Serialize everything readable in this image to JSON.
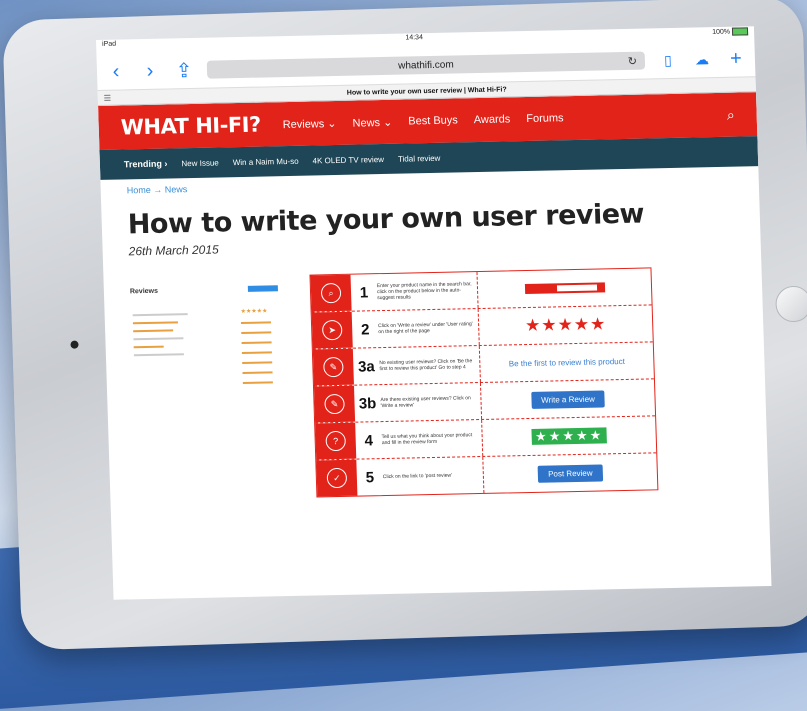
{
  "status": {
    "device": "iPad",
    "time": "14:34",
    "battery": "100%"
  },
  "browser": {
    "url": "whathifi.com",
    "tab_title": "How to write your own user review | What Hi-Fi?"
  },
  "site": {
    "logo": "WHAT HI-FI?",
    "nav": [
      "Reviews ⌄",
      "News ⌄",
      "Best Buys",
      "Awards",
      "Forums"
    ],
    "trending_label": "Trending ›",
    "trending": [
      "New Issue",
      "Win a Naim Mu-so",
      "4K OLED TV review",
      "Tidal review"
    ]
  },
  "article": {
    "breadcrumb": "Home → News",
    "title": "How to write your own user review",
    "date": "26th March 2015"
  },
  "figure": {
    "mini_title": "Reviews",
    "steps": [
      {
        "num": "1",
        "text": "Enter your product name in the search bar, click on the product below in the auto-suggest results",
        "icon": "search-icon"
      },
      {
        "num": "2",
        "text": "Click on 'Write a review' under 'User rating' on the right of the page",
        "icon": "pointer-icon",
        "visual": "★★★★★"
      },
      {
        "num": "3a",
        "text": "No existing user reviews? Click on 'Be the first to review this product' Go to step 4",
        "icon": "pencil-icon",
        "visual": "Be the first to review this product"
      },
      {
        "num": "3b",
        "text": "Are there existing user reviews? Click on 'Write a review'",
        "icon": "pencil-icon",
        "visual": "Write a Review"
      },
      {
        "num": "4",
        "text": "Tell us what you think about your product and fill in the review form",
        "icon": "question-icon",
        "visual": "★★★★★"
      },
      {
        "num": "5",
        "text": "Click on the link to 'post review'",
        "icon": "check-icon",
        "visual": "Post Review"
      }
    ]
  }
}
